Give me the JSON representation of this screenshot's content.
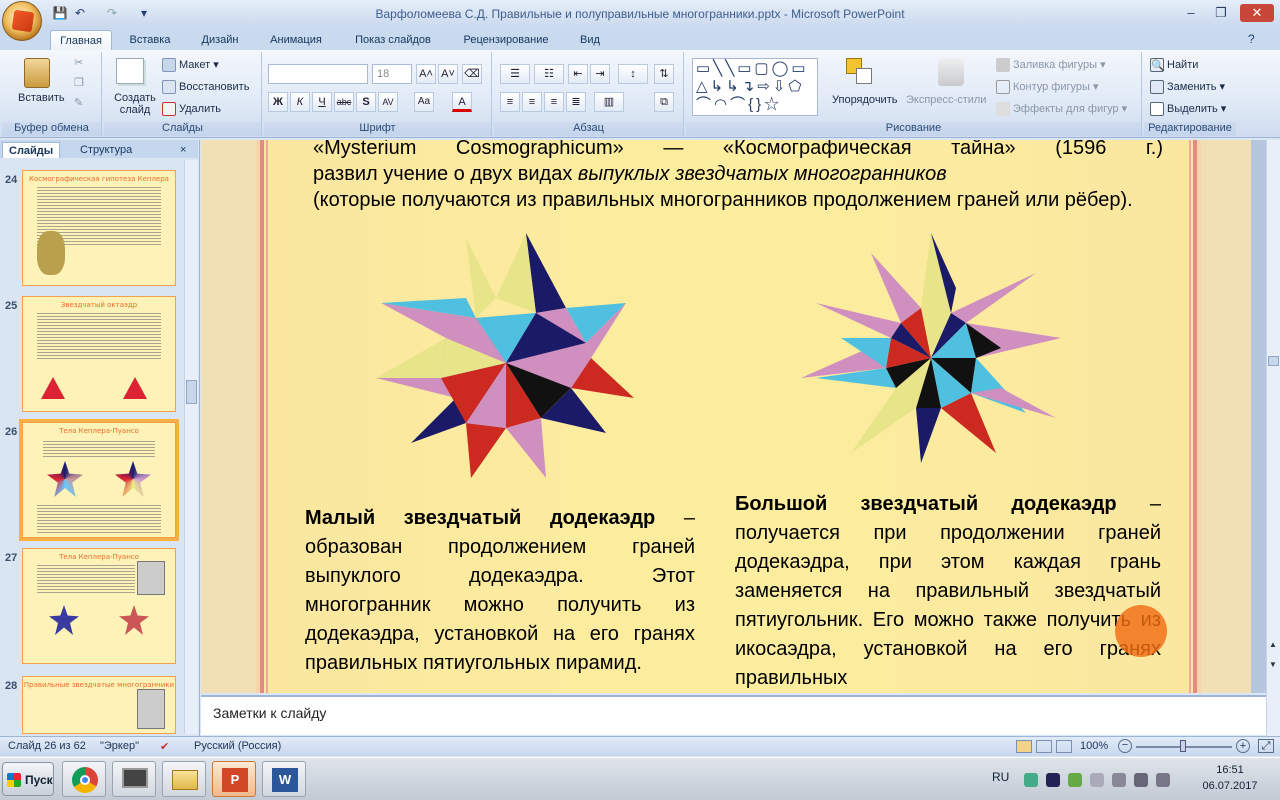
{
  "window": {
    "title": "Варфоломеева С.Д. Правильные и полуправильные многогранники.pptx - Microsoft PowerPoint"
  },
  "tabs": [
    "Главная",
    "Вставка",
    "Дизайн",
    "Анимация",
    "Показ слайдов",
    "Рецензирование",
    "Вид"
  ],
  "ribbon": {
    "clipboard": {
      "paste": "Вставить",
      "label": "Буфер обмена"
    },
    "slides": {
      "new_slide": "Создать слайд",
      "layout": "Макет",
      "reset": "Восстановить",
      "delete": "Удалить",
      "label": "Слайды"
    },
    "font": {
      "size": "18",
      "label": "Шрифт",
      "bold": "Ж",
      "italic": "К",
      "underline": "Ч",
      "strike": "abc",
      "shadow": "S",
      "spacing": "AV",
      "case": "Aa"
    },
    "paragraph": {
      "label": "Абзац"
    },
    "drawing": {
      "arrange": "Упорядочить",
      "quick_styles": "Экспресс-стили",
      "fill": "Заливка фигуры",
      "outline": "Контур фигуры",
      "effects": "Эффекты для фигур",
      "label": "Рисование"
    },
    "editing": {
      "find": "Найти",
      "replace": "Заменить",
      "select": "Выделить",
      "label": "Редактирование"
    }
  },
  "panel": {
    "tab_slides": "Слайды",
    "tab_outline": "Структура",
    "close": "×"
  },
  "thumbnails": [
    {
      "num": "24",
      "title": "Космографическая гипотеза Кеплера"
    },
    {
      "num": "25",
      "title": "Звездчатый октаэдр"
    },
    {
      "num": "26",
      "title": "Тела Кеплера-Пуансо"
    },
    {
      "num": "27",
      "title": "Тела Кеплера-Пуансо"
    },
    {
      "num": "28",
      "title": "Правильные звездчатые многогранники"
    }
  ],
  "slide": {
    "intro_line1": "«Mysterium Cosmographicum» — «Космографическая тайна» (1596 г.)",
    "intro_line2a": "развил учение о двух видах ",
    "intro_line2b": "выпуклых звездчатых многогранников",
    "intro_line3": "(которые получаются из правильных многогранников продолжением граней или рёбер).",
    "small_title": "Малый звездчатый додекаэдр",
    "small_text": " – образован продолжением граней выпуклого додекаэдра. Этот многогранник можно получить из додекаэдра, установкой на его гранях правильных пятиугольных пирамид.",
    "great_title": "Большой звездчатый додекаэдр",
    "great_text": " – получается при продолжении граней додекаэдра, при этом каждая грань заменяется на правильный звездчатый пятиугольник. Его можно также получить из икосаэдра, установкой на его гранях правильных"
  },
  "notes": {
    "placeholder": "Заметки к слайду"
  },
  "status": {
    "slide": "Слайд 26 из 62",
    "theme": "\"Эркер\"",
    "lang": "Русский (Россия)",
    "zoom": "100%"
  },
  "taskbar": {
    "start": "Пуск",
    "lang": "RU",
    "time": "16:51",
    "date": "06.07.2017"
  },
  "colors": {
    "accent": "#f07a2a",
    "slide_bg": "#fcee9e"
  }
}
